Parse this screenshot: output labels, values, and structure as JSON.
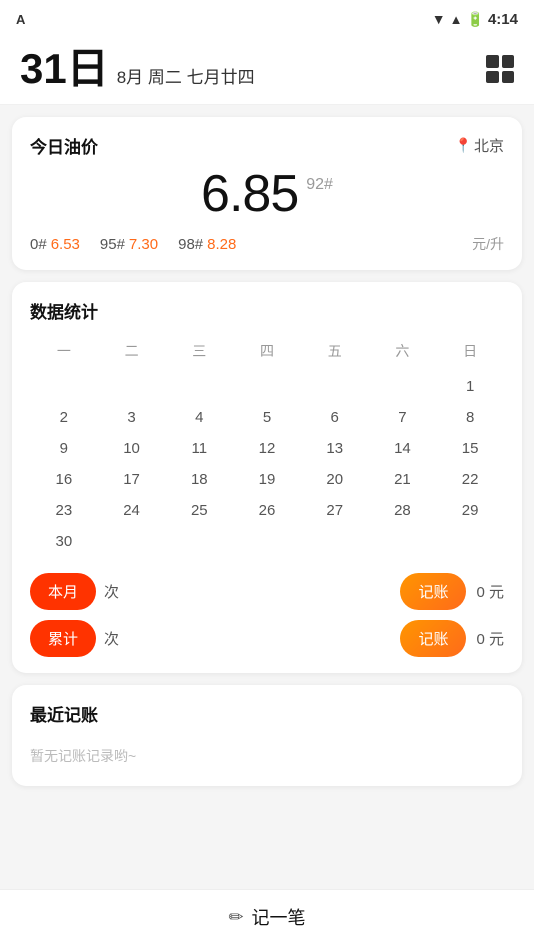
{
  "statusBar": {
    "leftLabel": "A",
    "time": "4:14"
  },
  "header": {
    "day": "31日",
    "dateInfo": "8月 周二 七月廿四"
  },
  "oilCard": {
    "title": "今日油价",
    "location": "北京",
    "mainPrice": "6.85",
    "mainGrade": "92#",
    "subPrices": [
      {
        "grade": "0#",
        "price": "6.53"
      },
      {
        "grade": "95#",
        "price": "7.30"
      },
      {
        "grade": "98#",
        "price": "8.28"
      }
    ],
    "unit": "元/升"
  },
  "statsCard": {
    "title": "数据统计",
    "weekDays": [
      "一",
      "二",
      "三",
      "四",
      "五",
      "六",
      "日"
    ],
    "calRows": [
      [
        "",
        "",
        "",
        "",
        "",
        "",
        "1"
      ],
      [
        "2",
        "3",
        "4",
        "5",
        "6",
        "7",
        "8"
      ],
      [
        "9",
        "10",
        "11",
        "12",
        "13",
        "14",
        "15"
      ],
      [
        "16",
        "17",
        "18",
        "19",
        "20",
        "21",
        "22"
      ],
      [
        "23",
        "24",
        "25",
        "26",
        "27",
        "28",
        "29"
      ],
      [
        "30",
        "",
        "",
        "",
        "",
        "",
        ""
      ]
    ],
    "todayDate": "31",
    "rows": [
      {
        "label": "本月",
        "unit": "次",
        "btnLabel": "记账",
        "amount": "0 元"
      },
      {
        "label": "累计",
        "unit": "次",
        "btnLabel": "记账",
        "amount": "0 元"
      }
    ]
  },
  "recentCard": {
    "title": "最近记账",
    "emptyText": "暂无记账记录哟~"
  },
  "bottomBar": {
    "icon": "✏",
    "label": "记一笔"
  }
}
